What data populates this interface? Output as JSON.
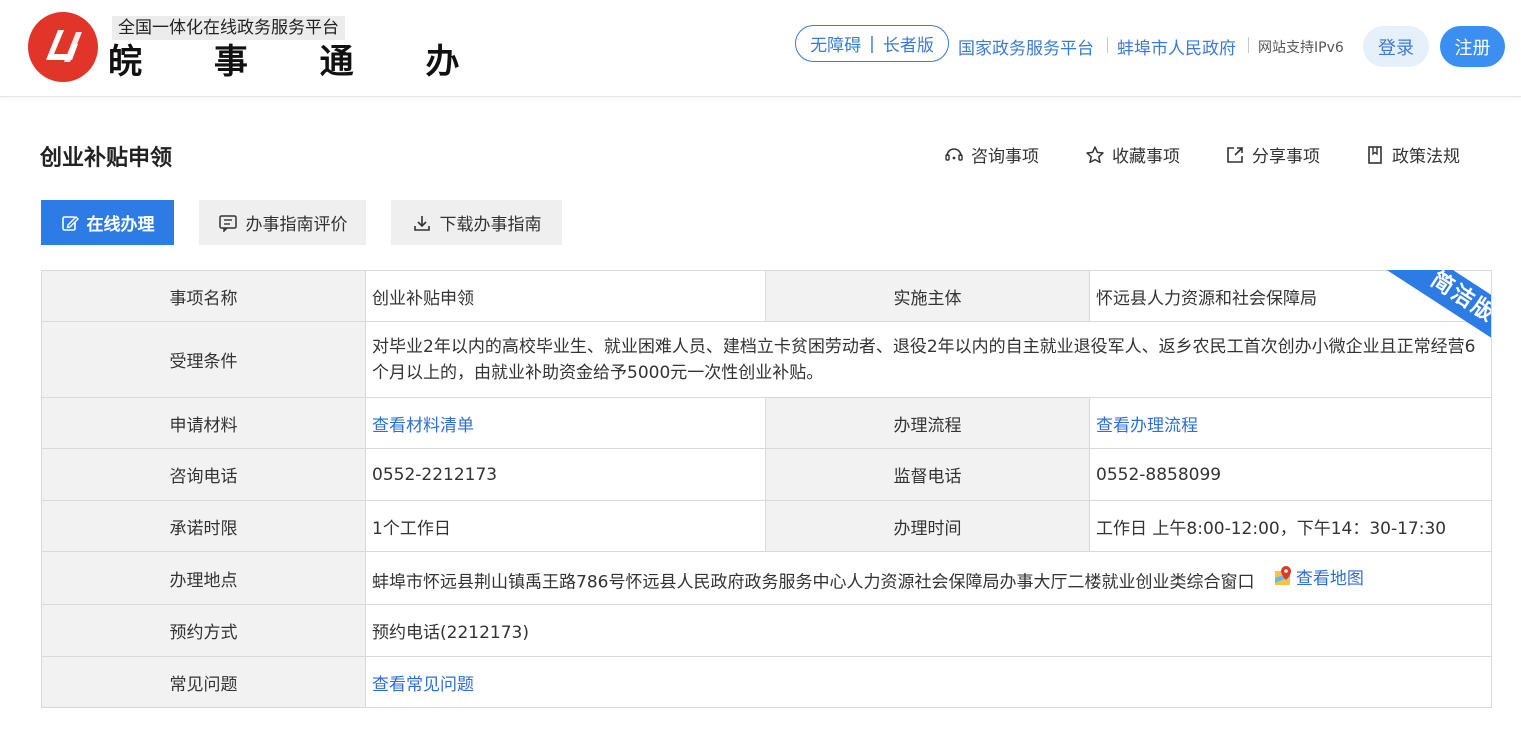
{
  "header": {
    "platform_tag": "全国一体化在线政务服务平台",
    "brand": "皖 事 通 办",
    "accessibility": {
      "left": "无障碍",
      "right": "长者版"
    },
    "links": [
      "国家政务服务平台",
      "蚌埠市人民政府"
    ],
    "ipv6": "网站支持IPv6",
    "login": "登录",
    "register": "注册"
  },
  "page": {
    "title": "创业补贴申领",
    "actions": [
      {
        "label": "咨询事项",
        "icon": "consult-icon"
      },
      {
        "label": "收藏事项",
        "icon": "star-icon"
      },
      {
        "label": "分享事项",
        "icon": "share-icon"
      },
      {
        "label": "政策法规",
        "icon": "book-icon"
      }
    ],
    "buttons": {
      "online": "在线办理",
      "evaluate": "办事指南评价",
      "download": "下载办事指南"
    }
  },
  "ribbon": "简洁版",
  "table": {
    "item_name": {
      "label": "事项名称",
      "value": "创业补贴申领"
    },
    "agency": {
      "label": "实施主体",
      "value": "怀远县人力资源和社会保障局"
    },
    "conditions": {
      "label": "受理条件",
      "value": "对毕业2年以内的高校毕业生、就业困难人员、建档立卡贫困劳动者、退役2年以内的自主就业退役军人、返乡农民工首次创办小微企业且正常经营6个月以上的，由就业补助资金给予5000元一次性创业补贴。"
    },
    "materials": {
      "label": "申请材料",
      "value": "查看材料清单"
    },
    "process": {
      "label": "办理流程",
      "value": "查看办理流程"
    },
    "phone": {
      "label": "咨询电话",
      "value": "0552-2212173"
    },
    "supervise_phone": {
      "label": "监督电话",
      "value": "0552-8858099"
    },
    "time_limit": {
      "label": "承诺时限",
      "value": "1个工作日"
    },
    "hours": {
      "label": "办理时间",
      "value": "工作日 上午8:00-12:00，下午14：30-17:30"
    },
    "location": {
      "label": "办理地点",
      "value": "蚌埠市怀远县荆山镇禹王路786号怀远县人民政府政务服务中心人力资源社会保障局办事大厅二楼就业创业类综合窗口",
      "map": "查看地图"
    },
    "appointment": {
      "label": "预约方式",
      "value": "预约电话(2212173)"
    },
    "faq": {
      "label": "常见问题",
      "value": "查看常见问题"
    }
  },
  "colors": {
    "brand_red": "#e2352a",
    "accent_blue": "#2d7be5",
    "link_blue": "#2d6fd6"
  }
}
